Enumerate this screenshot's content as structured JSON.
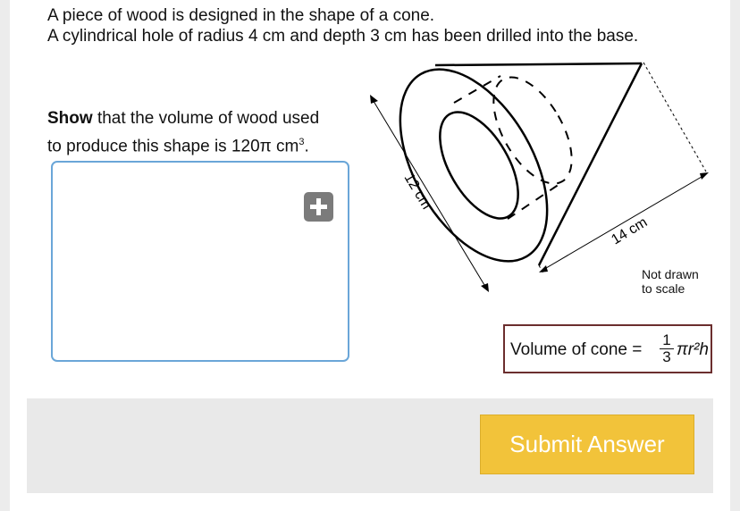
{
  "intro": {
    "line1": "A piece of wood is designed in the shape of a cone.",
    "line2": "A cylindrical hole of radius 4 cm and depth 3 cm has been drilled into the base."
  },
  "question": {
    "bold": "Show",
    "rest": " that the volume of wood used",
    "line2_pre": "to produce this shape is 120π cm",
    "line2_sup": "3",
    "line2_post": "."
  },
  "diagram": {
    "slant_label": "12 cm",
    "base_label": "14 cm",
    "note_line1": "Not drawn",
    "note_line2": "to scale"
  },
  "formula": {
    "text": "Volume of cone = ",
    "frac_num": "1",
    "frac_den": "3",
    "expr": "πr²h"
  },
  "add_icon": "plus-icon",
  "submit_label": "Submit Answer",
  "colors": {
    "accent": "#f2c33a",
    "box_border": "#6aa6d8",
    "formula_border": "#6b2e2e",
    "add_button": "#7b7b7b"
  }
}
